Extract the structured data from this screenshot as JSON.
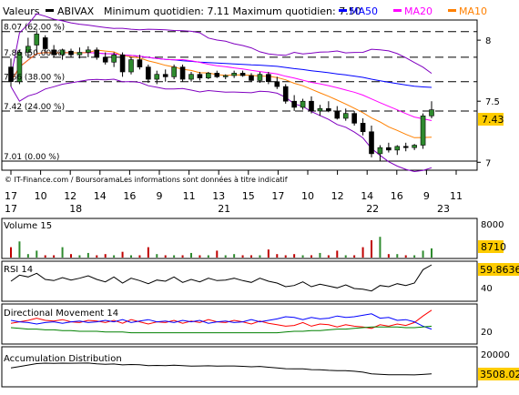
{
  "chart_data": [
    {
      "type": "candlestick",
      "title": "",
      "header": {
        "label": "Valeurs",
        "instrument": "ABIVAX",
        "range_text": "Minimum quotidien: 7.11 Maximum quotidien: 7.50",
        "legend": [
          {
            "name": "MA50",
            "color": "#0000ff"
          },
          {
            "name": "MA20",
            "color": "#ff00ff"
          },
          {
            "name": "MA10",
            "color": "#ff8000"
          }
        ]
      },
      "ylim": [
        6.95,
        8.15
      ],
      "y_ticks": [
        7,
        7.5,
        8
      ],
      "fib_levels": [
        {
          "value": 8.07,
          "label": "8.07 (62.00 %)"
        },
        {
          "value": 7.86,
          "label": "7.86 (50.00 %)"
        },
        {
          "value": 7.66,
          "label": "7.66 (38.00 %)"
        },
        {
          "value": 7.42,
          "label": "7.42 (24.00 %)"
        },
        {
          "value": 7.01,
          "label": "7.01 (0.00 %)"
        }
      ],
      "last_value": "7.43",
      "watermark": "© IT-Finance.com / BoursoramaLes informations sont données à titre indicatif",
      "x_tick_labels": [
        "17",
        "10",
        "12",
        "14",
        "16",
        "9",
        "11",
        "13",
        "15",
        "17",
        "10",
        "12",
        "14",
        "16",
        "9",
        "11"
      ],
      "x_month_labels": [
        "17",
        "18",
        "21",
        "22",
        "23"
      ],
      "candles": [
        {
          "o": 7.78,
          "h": 7.85,
          "l": 7.62,
          "c": 7.66
        },
        {
          "o": 7.66,
          "h": 7.92,
          "l": 7.64,
          "c": 7.9
        },
        {
          "o": 7.9,
          "h": 8.02,
          "l": 7.86,
          "c": 7.95
        },
        {
          "o": 7.96,
          "h": 8.08,
          "l": 7.9,
          "c": 8.05
        },
        {
          "o": 8.02,
          "h": 8.04,
          "l": 7.9,
          "c": 7.93
        },
        {
          "o": 7.92,
          "h": 7.96,
          "l": 7.86,
          "c": 7.88
        },
        {
          "o": 7.88,
          "h": 7.93,
          "l": 7.84,
          "c": 7.92
        },
        {
          "o": 7.91,
          "h": 7.93,
          "l": 7.86,
          "c": 7.88
        },
        {
          "o": 7.88,
          "h": 7.94,
          "l": 7.85,
          "c": 7.9
        },
        {
          "o": 7.9,
          "h": 7.95,
          "l": 7.86,
          "c": 7.92
        },
        {
          "o": 7.92,
          "h": 7.94,
          "l": 7.84,
          "c": 7.86
        },
        {
          "o": 7.86,
          "h": 7.9,
          "l": 7.8,
          "c": 7.82
        },
        {
          "o": 7.82,
          "h": 7.9,
          "l": 7.78,
          "c": 7.88
        },
        {
          "o": 7.88,
          "h": 7.9,
          "l": 7.7,
          "c": 7.74
        },
        {
          "o": 7.74,
          "h": 7.86,
          "l": 7.72,
          "c": 7.84
        },
        {
          "o": 7.84,
          "h": 7.88,
          "l": 7.76,
          "c": 7.78
        },
        {
          "o": 7.78,
          "h": 7.8,
          "l": 7.65,
          "c": 7.68
        },
        {
          "o": 7.68,
          "h": 7.75,
          "l": 7.64,
          "c": 7.72
        },
        {
          "o": 7.72,
          "h": 7.76,
          "l": 7.66,
          "c": 7.7
        },
        {
          "o": 7.7,
          "h": 7.8,
          "l": 7.68,
          "c": 7.78
        },
        {
          "o": 7.78,
          "h": 7.8,
          "l": 7.66,
          "c": 7.68
        },
        {
          "o": 7.68,
          "h": 7.74,
          "l": 7.66,
          "c": 7.72
        },
        {
          "o": 7.72,
          "h": 7.74,
          "l": 7.67,
          "c": 7.69
        },
        {
          "o": 7.69,
          "h": 7.74,
          "l": 7.68,
          "c": 7.73
        },
        {
          "o": 7.73,
          "h": 7.75,
          "l": 7.69,
          "c": 7.7
        },
        {
          "o": 7.7,
          "h": 7.72,
          "l": 7.68,
          "c": 7.71
        },
        {
          "o": 7.71,
          "h": 7.75,
          "l": 7.69,
          "c": 7.73
        },
        {
          "o": 7.73,
          "h": 7.75,
          "l": 7.7,
          "c": 7.71
        },
        {
          "o": 7.71,
          "h": 7.73,
          "l": 7.66,
          "c": 7.67
        },
        {
          "o": 7.67,
          "h": 7.74,
          "l": 7.65,
          "c": 7.72
        },
        {
          "o": 7.72,
          "h": 7.74,
          "l": 7.64,
          "c": 7.66
        },
        {
          "o": 7.66,
          "h": 7.7,
          "l": 7.6,
          "c": 7.62
        },
        {
          "o": 7.62,
          "h": 7.64,
          "l": 7.48,
          "c": 7.5
        },
        {
          "o": 7.5,
          "h": 7.55,
          "l": 7.42,
          "c": 7.45
        },
        {
          "o": 7.45,
          "h": 7.52,
          "l": 7.43,
          "c": 7.5
        },
        {
          "o": 7.5,
          "h": 7.54,
          "l": 7.4,
          "c": 7.42
        },
        {
          "o": 7.42,
          "h": 7.47,
          "l": 7.38,
          "c": 7.44
        },
        {
          "o": 7.44,
          "h": 7.5,
          "l": 7.41,
          "c": 7.42
        },
        {
          "o": 7.42,
          "h": 7.46,
          "l": 7.35,
          "c": 7.36
        },
        {
          "o": 7.36,
          "h": 7.44,
          "l": 7.34,
          "c": 7.4
        },
        {
          "o": 7.4,
          "h": 7.42,
          "l": 7.3,
          "c": 7.32
        },
        {
          "o": 7.32,
          "h": 7.36,
          "l": 7.22,
          "c": 7.25
        },
        {
          "o": 7.25,
          "h": 7.3,
          "l": 7.04,
          "c": 7.07
        },
        {
          "o": 7.07,
          "h": 7.14,
          "l": 7.01,
          "c": 7.12
        },
        {
          "o": 7.12,
          "h": 7.16,
          "l": 7.08,
          "c": 7.1
        },
        {
          "o": 7.1,
          "h": 7.14,
          "l": 7.06,
          "c": 7.13
        },
        {
          "o": 7.13,
          "h": 7.16,
          "l": 7.09,
          "c": 7.12
        },
        {
          "o": 7.12,
          "h": 7.15,
          "l": 7.1,
          "c": 7.14
        },
        {
          "o": 7.14,
          "h": 7.4,
          "l": 7.11,
          "c": 7.38
        },
        {
          "o": 7.38,
          "h": 7.5,
          "l": 7.36,
          "c": 7.43
        }
      ]
    },
    {
      "type": "bar",
      "title": "Volume 15",
      "y_ticks": [
        "8000"
      ],
      "last_value": "8710",
      "values": [
        900,
        1400,
        300,
        600,
        200,
        200,
        900,
        300,
        200,
        400,
        200,
        300,
        200,
        500,
        200,
        200,
        900,
        300,
        200,
        200,
        200,
        400,
        200,
        200,
        600,
        200,
        300,
        200,
        200,
        200,
        700,
        300,
        200,
        300,
        200,
        200,
        400,
        200,
        600,
        200,
        200,
        900,
        1500,
        1800,
        300,
        300,
        200,
        200,
        600,
        800
      ]
    },
    {
      "type": "line",
      "title": "RSI 14",
      "y_ticks": [
        "40"
      ],
      "last_value": "59.8636",
      "ylim": [
        15,
        75
      ],
      "values": [
        45,
        55,
        52,
        58,
        48,
        46,
        51,
        47,
        50,
        54,
        48,
        44,
        52,
        42,
        50,
        46,
        41,
        47,
        45,
        52,
        43,
        48,
        44,
        50,
        46,
        47,
        50,
        46,
        43,
        50,
        45,
        42,
        36,
        38,
        44,
        36,
        40,
        37,
        34,
        39,
        33,
        32,
        29,
        38,
        36,
        41,
        38,
        42,
        64,
        72
      ]
    },
    {
      "type": "line",
      "title": "Directional Movement 14",
      "y_ticks": [
        "20"
      ],
      "ylim": [
        0,
        50
      ],
      "series": [
        {
          "color": "#ff0000",
          "values": [
            26,
            28,
            30,
            33,
            30,
            29,
            31,
            28,
            27,
            30,
            29,
            27,
            30,
            26,
            31,
            28,
            25,
            28,
            27,
            30,
            26,
            29,
            27,
            31,
            28,
            27,
            30,
            28,
            25,
            29,
            26,
            24,
            22,
            23,
            27,
            22,
            25,
            24,
            21,
            24,
            22,
            21,
            19,
            24,
            22,
            25,
            23,
            27,
            36,
            44
          ]
        },
        {
          "color": "#0000ff",
          "values": [
            30,
            28,
            27,
            25,
            27,
            28,
            26,
            28,
            29,
            27,
            28,
            30,
            28,
            31,
            27,
            29,
            31,
            28,
            29,
            27,
            30,
            28,
            30,
            26,
            28,
            29,
            27,
            28,
            31,
            28,
            30,
            32,
            35,
            34,
            31,
            34,
            32,
            33,
            36,
            34,
            35,
            37,
            39,
            33,
            34,
            30,
            31,
            28,
            22,
            18
          ]
        },
        {
          "color": "#008000",
          "values": [
            20,
            19,
            18,
            18,
            17,
            17,
            16,
            16,
            15,
            15,
            15,
            14,
            14,
            14,
            13,
            13,
            13,
            13,
            13,
            13,
            13,
            13,
            13,
            13,
            13,
            13,
            13,
            13,
            13,
            13,
            13,
            13,
            14,
            15,
            15,
            16,
            16,
            17,
            18,
            18,
            19,
            20,
            21,
            21,
            21,
            21,
            20,
            20,
            21,
            22
          ]
        }
      ]
    },
    {
      "type": "line",
      "title": "Accumulation Distribution",
      "y_ticks": [
        "20000"
      ],
      "last_value": "3508.024",
      "ylim": [
        -4000,
        26000
      ],
      "values": [
        10000,
        11200,
        12400,
        13600,
        14000,
        13800,
        14000,
        13900,
        14000,
        14100,
        13400,
        13000,
        13300,
        12600,
        12900,
        12700,
        12000,
        12100,
        12000,
        12300,
        12000,
        11600,
        11700,
        11800,
        11500,
        11700,
        11700,
        11400,
        11000,
        11300,
        10600,
        10000,
        9400,
        9300,
        9300,
        8700,
        8600,
        8100,
        7800,
        7800,
        7300,
        6600,
        5200,
        4800,
        4500,
        4400,
        4400,
        4300,
        4700,
        5200
      ]
    }
  ]
}
